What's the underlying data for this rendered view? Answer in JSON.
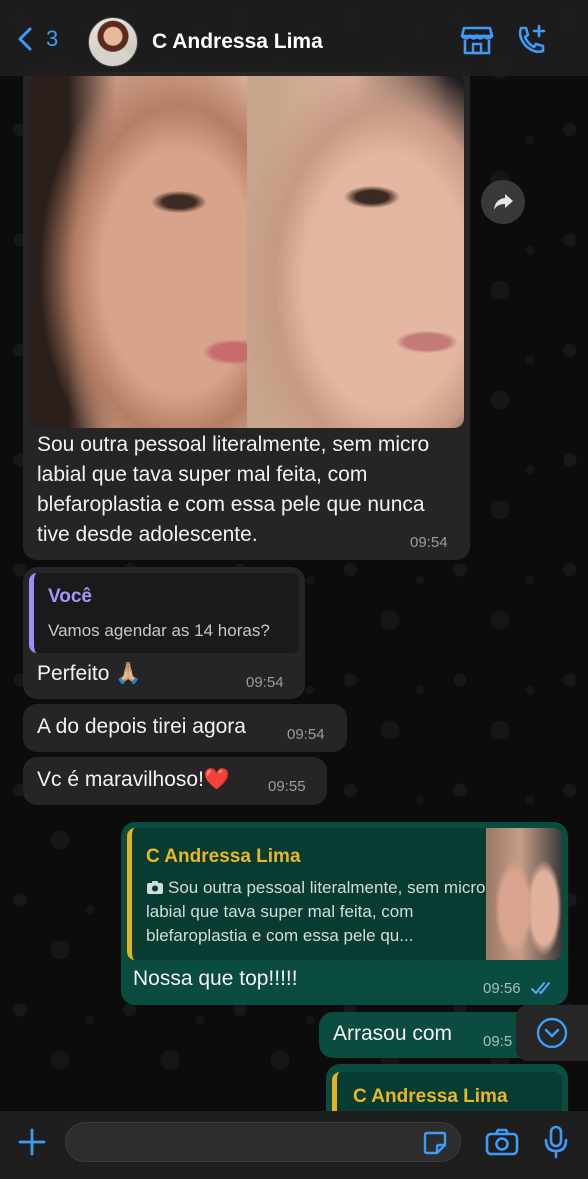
{
  "header": {
    "back_count": "3",
    "contact_name": "C Andressa Lima"
  },
  "messages": {
    "photo_caption": "Sou outra pessoal literalmente, sem micro labial que tava super mal feita, com blefaroplastia e com essa pele que nunca tive desde adolescente.",
    "photo_time": "09:54",
    "reply_author": "Você",
    "reply_quoted": "Vamos agendar as 14 horas?",
    "reply_text": "Perfeito 🙏🏼",
    "reply_time": "09:54",
    "msg3_text": "A do depois tirei agora",
    "msg3_time": "09:54",
    "msg4_text": "Vc é maravilhoso!❤️",
    "msg4_time": "09:55",
    "out_quote_author": "C Andressa Lima",
    "out_quote_text": "Sou outra pessoal literalmente, sem micro labial que tava super mal feita, com blefaroplastia e com essa pele qu...",
    "out_reply_text": "Nossa que top!!!!!",
    "out_reply_time": "09:56",
    "out6_text": "Arrasou com",
    "out6_time": "09:5",
    "out7_quote_author": "C Andressa Lima"
  },
  "colors": {
    "accent_blue": "#3e9bf6",
    "incoming_bubble": "#252525",
    "outgoing_bubble": "#0a4c3f",
    "quote_purple": "#a597f8",
    "quote_yellow": "#eab726"
  },
  "icons": [
    "chevron-left-icon",
    "store-icon",
    "phone-add-icon",
    "forward-icon",
    "camera-icon",
    "double-check-icon",
    "chevron-down-icon",
    "plus-icon",
    "sticker-icon",
    "mic-icon"
  ]
}
